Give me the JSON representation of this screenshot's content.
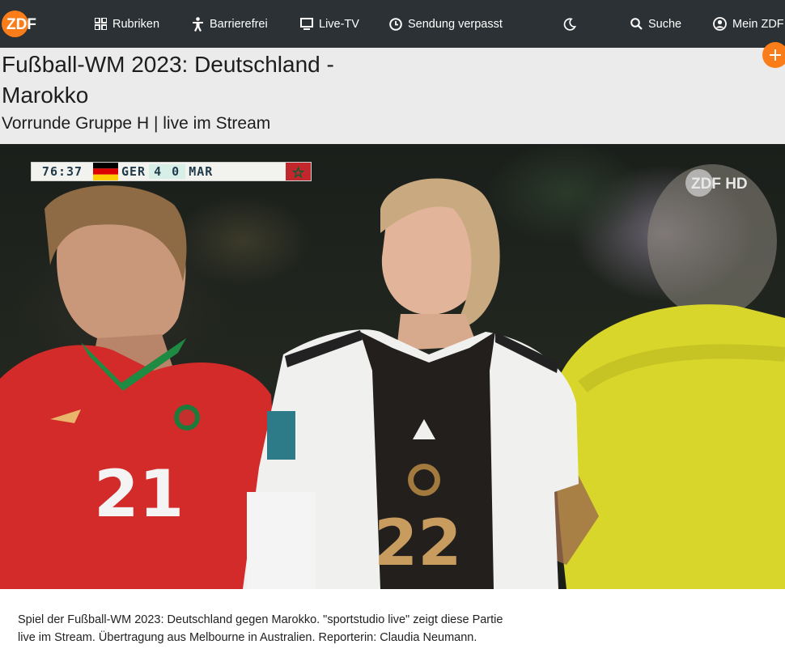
{
  "nav": {
    "logo_text": "ZDF",
    "items": [
      {
        "label": "Rubriken",
        "icon": "grid-icon"
      },
      {
        "label": "Barrierefrei",
        "icon": "accessibility-icon"
      },
      {
        "label": "Live-TV",
        "icon": "tv-icon"
      },
      {
        "label": "Sendung verpasst",
        "icon": "clock-icon"
      },
      {
        "label": "",
        "icon": "moon-icon"
      },
      {
        "label": "Suche",
        "icon": "search-icon"
      },
      {
        "label": "Mein ZDF",
        "icon": "user-icon"
      }
    ]
  },
  "header": {
    "title": "Fußball-WM 2023: Deutschland - Marokko",
    "subtitle": "Vorrunde Gruppe H | live im Stream"
  },
  "video": {
    "scoreboard": {
      "time": "76:37",
      "home_team": "GER",
      "home_score": "4",
      "away_score": "0",
      "away_team": "MAR"
    },
    "channel_logo": "ZDF HD",
    "players": [
      {
        "number": "21",
        "kit": "red"
      },
      {
        "number": "22",
        "kit": "white-black"
      }
    ]
  },
  "description": "Spiel der Fußball-WM 2023: Deutschland gegen Marokko. \"sportstudio live\" zeigt diese Partie live im Stream. Übertragung aus Melbourne in Australien. Reporterin: Claudia Neumann.",
  "colors": {
    "accent": "#fa7d19",
    "nav_bg": "#2b3134",
    "header_bg": "#ebebeb"
  }
}
